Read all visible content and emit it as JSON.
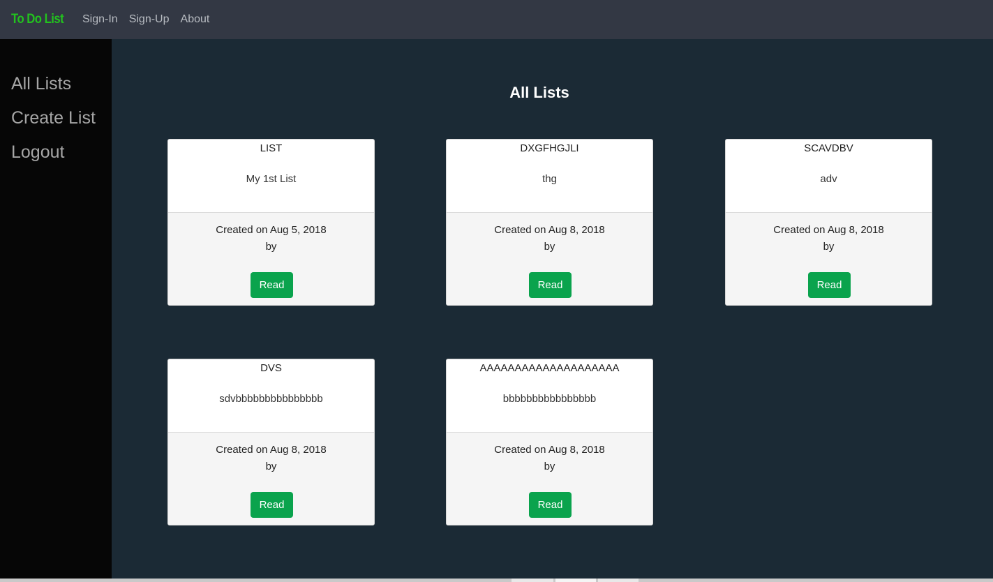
{
  "topnav": {
    "brand": "To Do List",
    "links": [
      {
        "label": "Sign-In"
      },
      {
        "label": "Sign-Up"
      },
      {
        "label": "About"
      }
    ]
  },
  "sidebar": {
    "items": [
      {
        "label": "All Lists"
      },
      {
        "label": "Create List"
      },
      {
        "label": "Logout"
      }
    ]
  },
  "main": {
    "title": "All Lists",
    "cards": [
      {
        "title": "LIST",
        "description": "My 1st List",
        "created": "Created on Aug 5, 2018",
        "by": "by",
        "button": "Read"
      },
      {
        "title": "DXGFHGJLI",
        "description": "thg",
        "created": "Created on Aug 8, 2018",
        "by": "by",
        "button": "Read"
      },
      {
        "title": "SCAVDBV",
        "description": "adv",
        "created": "Created on Aug 8, 2018",
        "by": "by",
        "button": "Read"
      },
      {
        "title": "DVS",
        "description": "sdvbbbbbbbbbbbbbbb",
        "created": "Created on Aug 8, 2018",
        "by": "by",
        "button": "Read"
      },
      {
        "title": "AAAAAAAAAAAAAAAAAAAA",
        "description": "bbbbbbbbbbbbbbbb",
        "created": "Created on Aug 8, 2018",
        "by": "by",
        "button": "Read"
      }
    ]
  },
  "colors": {
    "brand": "#22c21e",
    "topnav_bg": "#333844",
    "sidebar_bg": "#060606",
    "main_bg": "#1b2a35",
    "button_bg": "#0aa34d"
  }
}
